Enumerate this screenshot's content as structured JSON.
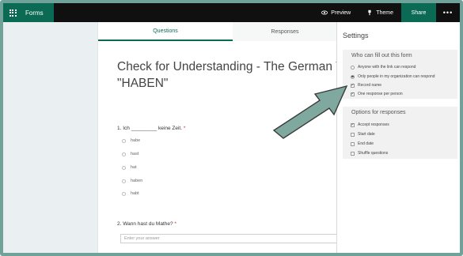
{
  "topbar": {
    "app_name": "Forms",
    "preview_label": "Preview",
    "theme_label": "Theme",
    "share_label": "Share",
    "more_label": "•••"
  },
  "tabs": [
    {
      "label": "Questions",
      "active": true
    },
    {
      "label": "Responses",
      "active": false
    }
  ],
  "form": {
    "title_line1": "Check for Understanding - The German Ver",
    "title_line2": "\"HABEN\"",
    "questions": [
      {
        "title": "1. Ich _________ keine Zeit.",
        "required": "*",
        "options": [
          "habe",
          "hast",
          "hat",
          "haben",
          "habt"
        ]
      },
      {
        "title": "2. Wann hast du Mathe?",
        "required": "*",
        "placeholder": "Enter your answer"
      }
    ]
  },
  "settings": {
    "title": "Settings",
    "who_can_fill": {
      "title": "Who can fill out this form",
      "options": [
        {
          "label": "Anyone with the link can respond",
          "type": "radio",
          "checked": false
        },
        {
          "label": "Only people in my organization can respond",
          "type": "radio",
          "checked": true
        },
        {
          "label": "Record name",
          "type": "checkbox",
          "checked": true
        },
        {
          "label": "One response per person",
          "type": "checkbox",
          "checked": true
        }
      ]
    },
    "options_for_responses": {
      "title": "Options for responses",
      "options": [
        {
          "label": "Accept responses",
          "type": "checkbox",
          "checked": true
        },
        {
          "label": "Start date",
          "type": "checkbox",
          "checked": false
        },
        {
          "label": "End date",
          "type": "checkbox",
          "checked": false
        },
        {
          "label": "Shuffle questions",
          "type": "checkbox",
          "checked": false
        }
      ]
    }
  },
  "colors": {
    "brand": "#0b6a53",
    "topbar": "#101010",
    "frame": "#6fa39a",
    "arrow_fill": "#7fa89e",
    "required": "#c3321e"
  }
}
